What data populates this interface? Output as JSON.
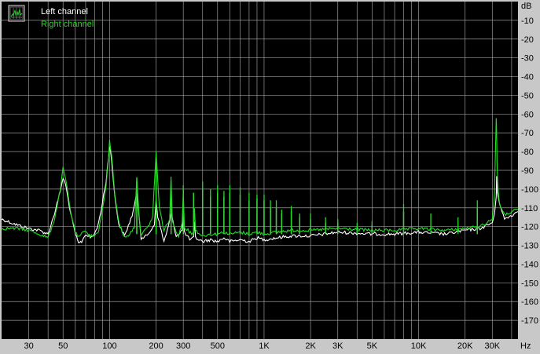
{
  "chart_data": {
    "type": "line",
    "title": "",
    "xlabel": "Hz",
    "ylabel": "dB",
    "x_scale": "log",
    "xlim": [
      20,
      44000
    ],
    "ylim": [
      -180,
      0
    ],
    "grid": true,
    "legend_position": "top-left",
    "x_ticks": [
      {
        "value": 30,
        "label": "30"
      },
      {
        "value": 50,
        "label": "50"
      },
      {
        "value": 100,
        "label": "100"
      },
      {
        "value": 200,
        "label": "200"
      },
      {
        "value": 300,
        "label": "300"
      },
      {
        "value": 500,
        "label": "500"
      },
      {
        "value": 1000,
        "label": "1K"
      },
      {
        "value": 2000,
        "label": "2K"
      },
      {
        "value": 3000,
        "label": "3K"
      },
      {
        "value": 5000,
        "label": "5K"
      },
      {
        "value": 10000,
        "label": "10K"
      },
      {
        "value": 20000,
        "label": "20K"
      },
      {
        "value": 30000,
        "label": "30K"
      }
    ],
    "y_ticks": [
      {
        "value": -10,
        "label": "-10"
      },
      {
        "value": -20,
        "label": "-20"
      },
      {
        "value": -30,
        "label": "-30"
      },
      {
        "value": -40,
        "label": "-40"
      },
      {
        "value": -50,
        "label": "-50"
      },
      {
        "value": -60,
        "label": "-60"
      },
      {
        "value": -70,
        "label": "-70"
      },
      {
        "value": -80,
        "label": "-80"
      },
      {
        "value": -90,
        "label": "-90"
      },
      {
        "value": -100,
        "label": "-100"
      },
      {
        "value": -110,
        "label": "-110"
      },
      {
        "value": -120,
        "label": "-120"
      },
      {
        "value": -130,
        "label": "-130"
      },
      {
        "value": -140,
        "label": "-140"
      },
      {
        "value": -150,
        "label": "-150"
      },
      {
        "value": -160,
        "label": "-160"
      },
      {
        "value": -170,
        "label": "-170"
      }
    ],
    "series": [
      {
        "name": "Left channel",
        "color": "#ffffff",
        "x": [
          20,
          25,
          30,
          35,
          40,
          44,
          48,
          50,
          52,
          56,
          60,
          63,
          66,
          70,
          75,
          80,
          85,
          90,
          95,
          98,
          100,
          103,
          108,
          115,
          125,
          140,
          148,
          150,
          152,
          160,
          175,
          195,
          200,
          205,
          225,
          240,
          245,
          250,
          270,
          295,
          300,
          305,
          330,
          350,
          355,
          360,
          400,
          450,
          500,
          550,
          600,
          700,
          800,
          900,
          1000,
          1200,
          1500,
          2000,
          3000,
          5000,
          7000,
          10000,
          15000,
          20000,
          25000,
          30000,
          31000,
          31800,
          32000,
          32300,
          33000,
          34000,
          36000,
          40000,
          44000
        ],
        "y": [
          -116,
          -119,
          -121,
          -122,
          -124,
          -113,
          -101,
          -94,
          -98,
          -113,
          -124,
          -129,
          -128,
          -124,
          -126,
          -124,
          -118,
          -107,
          -96,
          -84,
          -77,
          -84,
          -104,
          -119,
          -125,
          -114,
          -105,
          -99,
          -106,
          -126,
          -125,
          -119,
          -105,
          -115,
          -128,
          -120,
          -117,
          -113,
          -125,
          -122,
          -110,
          -123,
          -127,
          -126,
          -118,
          -126,
          -128,
          -127,
          -128,
          -126,
          -128,
          -127,
          -128,
          -126,
          -127,
          -126,
          -125,
          -125,
          -123,
          -124,
          -124,
          -123,
          -124,
          -122,
          -121,
          -118,
          -113,
          -105,
          -93,
          -101,
          -105,
          -110,
          -116,
          -114,
          -112
        ]
      },
      {
        "name": "Right channel",
        "color": "#22dd22",
        "x": [
          20,
          25,
          30,
          35,
          40,
          44,
          48,
          50,
          52,
          56,
          60,
          63,
          66,
          70,
          75,
          80,
          85,
          90,
          95,
          98,
          100,
          103,
          108,
          115,
          125,
          135,
          145,
          150,
          155,
          160,
          175,
          190,
          200,
          210,
          225,
          245,
          250,
          255,
          280,
          295,
          300,
          305,
          340,
          350,
          355,
          360,
          400,
          450,
          500,
          550,
          600,
          700,
          800,
          900,
          1000,
          1200,
          1500,
          2000,
          3000,
          5000,
          7000,
          10000,
          15000,
          20000,
          25000,
          30000,
          31000,
          31800,
          32000,
          32300,
          33000,
          34000,
          36000,
          40000,
          44000
        ],
        "y": [
          -121,
          -121,
          -122,
          -124,
          -126,
          -116,
          -100,
          -89,
          -95,
          -112,
          -123,
          -126,
          -124,
          -122,
          -125,
          -125,
          -122,
          -111,
          -98,
          -86,
          -74,
          -82,
          -102,
          -118,
          -126,
          -124,
          -120,
          -93,
          -114,
          -124,
          -121,
          -115,
          -80,
          -110,
          -122,
          -116,
          -93,
          -118,
          -125,
          -118,
          -101,
          -120,
          -124,
          -122,
          -110,
          -122,
          -125,
          -124,
          -124,
          -123,
          -124,
          -123,
          -124,
          -123,
          -124,
          -123,
          -122,
          -122,
          -121,
          -122,
          -122,
          -121,
          -122,
          -121,
          -120,
          -116,
          -103,
          -62,
          -68,
          -90,
          -104,
          -110,
          -114,
          -112,
          -111
        ]
      }
    ],
    "harmonic_spikes": {
      "Left channel": [
        {
          "x": 150,
          "y": -96
        },
        {
          "x": 200,
          "y": -83
        },
        {
          "x": 250,
          "y": -100
        },
        {
          "x": 300,
          "y": -100
        },
        {
          "x": 350,
          "y": -102
        },
        {
          "x": 400,
          "y": -100
        },
        {
          "x": 450,
          "y": -104
        },
        {
          "x": 500,
          "y": -102
        },
        {
          "x": 550,
          "y": -104
        },
        {
          "x": 600,
          "y": -102
        },
        {
          "x": 700,
          "y": -103
        },
        {
          "x": 800,
          "y": -106
        },
        {
          "x": 900,
          "y": -105
        },
        {
          "x": 1000,
          "y": -106
        },
        {
          "x": 1100,
          "y": -110
        },
        {
          "x": 1200,
          "y": -110
        },
        {
          "x": 1300,
          "y": -113
        },
        {
          "x": 1500,
          "y": -112
        },
        {
          "x": 1700,
          "y": -115
        },
        {
          "x": 2000,
          "y": -116
        },
        {
          "x": 2500,
          "y": -118
        },
        {
          "x": 3000,
          "y": -118
        },
        {
          "x": 4000,
          "y": -120
        },
        {
          "x": 5000,
          "y": -119
        },
        {
          "x": 8000,
          "y": -112
        },
        {
          "x": 24000,
          "y": -110
        }
      ],
      "Right channel": [
        {
          "x": 150,
          "y": -94
        },
        {
          "x": 200,
          "y": -80
        },
        {
          "x": 250,
          "y": -96
        },
        {
          "x": 300,
          "y": -98
        },
        {
          "x": 350,
          "y": -102
        },
        {
          "x": 400,
          "y": -96
        },
        {
          "x": 450,
          "y": -100
        },
        {
          "x": 500,
          "y": -98
        },
        {
          "x": 550,
          "y": -101
        },
        {
          "x": 600,
          "y": -98
        },
        {
          "x": 700,
          "y": -99
        },
        {
          "x": 800,
          "y": -102
        },
        {
          "x": 900,
          "y": -103
        },
        {
          "x": 1000,
          "y": -103
        },
        {
          "x": 1100,
          "y": -106
        },
        {
          "x": 1200,
          "y": -106
        },
        {
          "x": 1300,
          "y": -111
        },
        {
          "x": 1500,
          "y": -109
        },
        {
          "x": 1700,
          "y": -113
        },
        {
          "x": 2000,
          "y": -113
        },
        {
          "x": 2500,
          "y": -115
        },
        {
          "x": 3000,
          "y": -116
        },
        {
          "x": 4000,
          "y": -118
        },
        {
          "x": 5000,
          "y": -117
        },
        {
          "x": 8000,
          "y": -108
        },
        {
          "x": 12000,
          "y": -113
        },
        {
          "x": 18000,
          "y": -115
        },
        {
          "x": 24000,
          "y": -106
        }
      ]
    }
  }
}
